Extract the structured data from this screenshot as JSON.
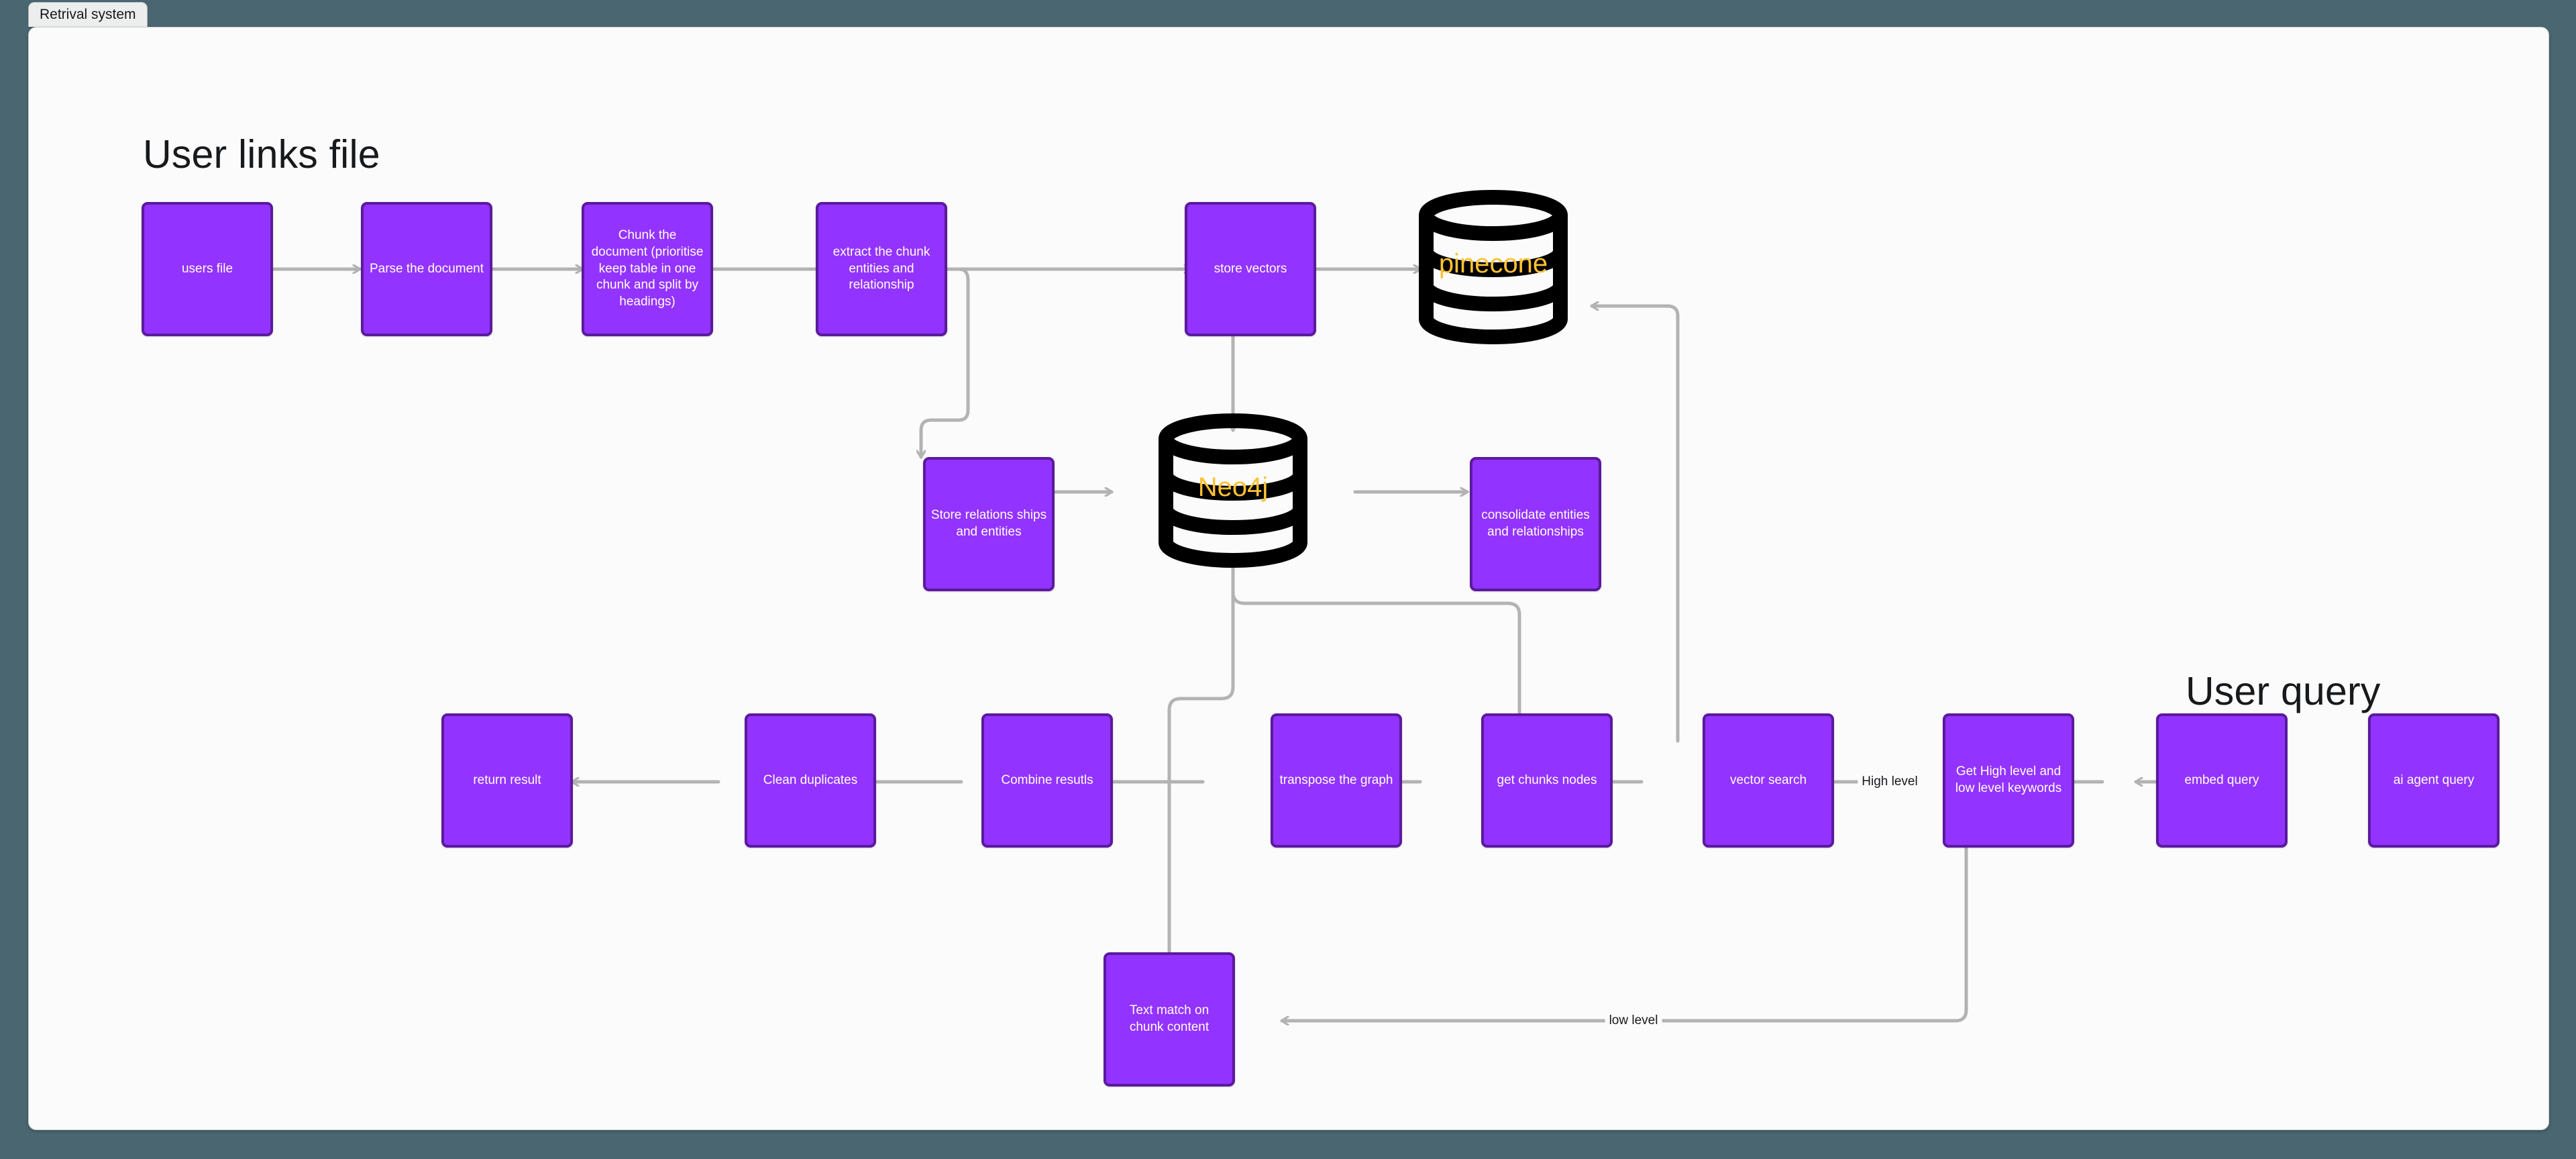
{
  "window": {
    "tab_label": "Retrival system",
    "background_color": "#4a6670",
    "canvas_color": "#fbfbfc"
  },
  "theme": {
    "node_fill": "#9333ff",
    "node_border": "#5b1a9e",
    "node_text": "#ffffff",
    "edge_color": "#b3b3b3",
    "db_stroke": "#000000",
    "db_label_color": "#ffc233",
    "heading_color": "#17191b"
  },
  "sections": [
    {
      "id": "user-links-file",
      "title": "User links file"
    },
    {
      "id": "user-query",
      "title": "User query"
    }
  ],
  "nodes": [
    {
      "id": "users-file",
      "label": "users file"
    },
    {
      "id": "parse-the-document",
      "label": "Parse the document"
    },
    {
      "id": "chunk-the-document",
      "label": "Chunk the document (prioritise keep table in one chunk and split by headings)"
    },
    {
      "id": "extract-the-chunk-entities",
      "label": "extract the chunk entities and relationship"
    },
    {
      "id": "store-vectors",
      "label": "store vectors"
    },
    {
      "id": "store-relationships-and-entities",
      "label": "Store relations ships and entities"
    },
    {
      "id": "consolidate-entities-and-relationships",
      "label": "consolidate entities and relationships"
    },
    {
      "id": "return-result",
      "label": "return result"
    },
    {
      "id": "clean-duplicates",
      "label": "Clean duplicates"
    },
    {
      "id": "combine-results",
      "label": "Combine resutls"
    },
    {
      "id": "transpose-the-graph",
      "label": "transpose the graph"
    },
    {
      "id": "get-chunks-nodes",
      "label": "get chunks nodes"
    },
    {
      "id": "vector-search",
      "label": "vector search"
    },
    {
      "id": "get-keywords",
      "label": "Get High level and low level keywords"
    },
    {
      "id": "embed-query",
      "label": "embed query"
    },
    {
      "id": "ai-agent-query",
      "label": "ai agent query"
    },
    {
      "id": "text-match-on-chunk-content",
      "label": "Text match on chunk content"
    }
  ],
  "databases": [
    {
      "id": "pinecone",
      "label": "pinecone"
    },
    {
      "id": "neo4j",
      "label": "Neo4j"
    }
  ],
  "edge_labels": [
    {
      "id": "high-level",
      "label": "High level"
    },
    {
      "id": "low-level",
      "label": "low level"
    }
  ]
}
